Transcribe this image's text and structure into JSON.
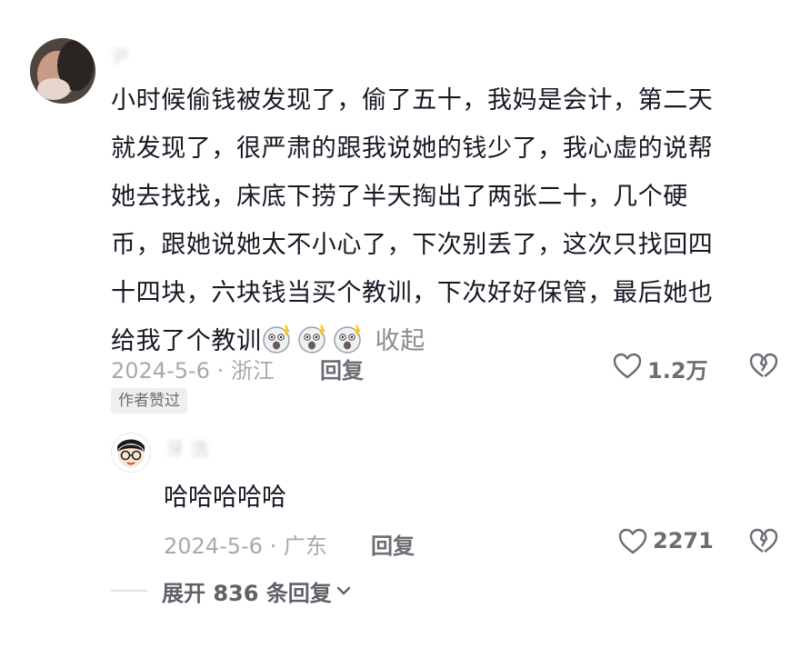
{
  "main_comment": {
    "username": "尹",
    "lines": [
      "小时候偷钱被发现了，偷了五十，我妈是会计，第二天",
      "就发现了，很严肃的跟我说她的钱少了，我心虚的说帮",
      "她去找找，床底下捞了半天掏出了两张二十，几个硬",
      "币，跟她说她太不小心了，下次别丢了，这次只找回四",
      "十四块，六块钱当买个教训，下次好好保管，最后她也"
    ],
    "last_line": "给我了个教训",
    "emojis": [
      "shocked-face-icon",
      "shocked-face-icon",
      "shocked-face-icon"
    ],
    "collapse_label": "收起",
    "meta": "2024-5-6 · 浙江",
    "reply_label": "回复",
    "like_count": "1.2万",
    "author_badge": "作者赞过"
  },
  "reply_comment": {
    "username": "牙 浩",
    "text": "哈哈哈哈哈",
    "meta": "2024-5-6 · 广东",
    "reply_label": "回复",
    "like_count": "2271"
  },
  "expand": {
    "label": "展开 836 条回复"
  },
  "colors": {
    "text_primary": "#161823",
    "text_secondary": "#a8a9ae",
    "badge_bg": "#efeff1"
  }
}
